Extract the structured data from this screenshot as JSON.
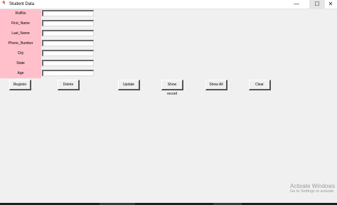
{
  "window": {
    "title": "Student Data",
    "icon": "feather-icon",
    "controls": {
      "minimize": "—",
      "maximize": "☐",
      "close": "✕"
    }
  },
  "form": {
    "fields": [
      {
        "label": "RollNo",
        "value": ""
      },
      {
        "label": "First_Name",
        "value": ""
      },
      {
        "label": "Last_Name",
        "value": ""
      },
      {
        "label": "Phone_Number",
        "value": ""
      },
      {
        "label": "City",
        "value": ""
      },
      {
        "label": "State",
        "value": ""
      },
      {
        "label": "Age",
        "value": ""
      }
    ]
  },
  "buttons": {
    "register": "Register",
    "delete": "Delete",
    "update": "Update",
    "show_record": "Show record",
    "show_all": "Show All",
    "clear": "Clear"
  },
  "watermark": {
    "title": "Activate Windows",
    "subtitle": "Go to Settings to activate"
  },
  "colors": {
    "label_panel": "#ffc0cb",
    "window_bg": "#f0f0f0",
    "icon_red": "#c0392b"
  }
}
